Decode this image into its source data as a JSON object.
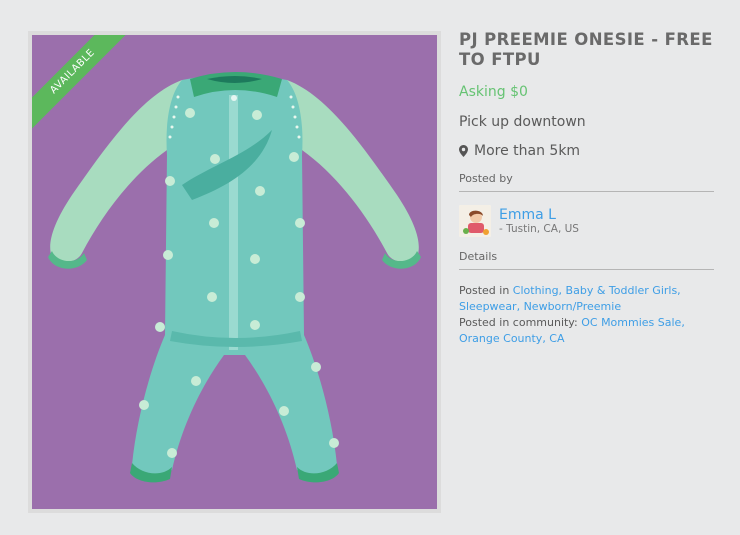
{
  "listing": {
    "badge": "AVAILABLE",
    "title": "PJ PREEMIE ONESIE - FREE TO FTPU",
    "price": "Asking $0",
    "pickup": "Pick up downtown",
    "distance": "More than 5km",
    "icons": {
      "distance": "map-pin-icon"
    }
  },
  "poster": {
    "label": "Posted by",
    "name": "Emma L",
    "location": "- Tustin, CA, US"
  },
  "details": {
    "label": "Details",
    "posted_in_prefix": "Posted in ",
    "categories": "Clothing, Baby & Toddler Girls, Sleepwear, Newborn/Preemie",
    "community_prefix": "Posted in community: ",
    "community": "OC Mommies Sale, Orange County, CA"
  },
  "colors": {
    "background": "#e8e9ea",
    "photo_background": "#9b6fac",
    "badge": "#5cb85c",
    "price": "#66c373",
    "link": "#3e9ee6"
  }
}
